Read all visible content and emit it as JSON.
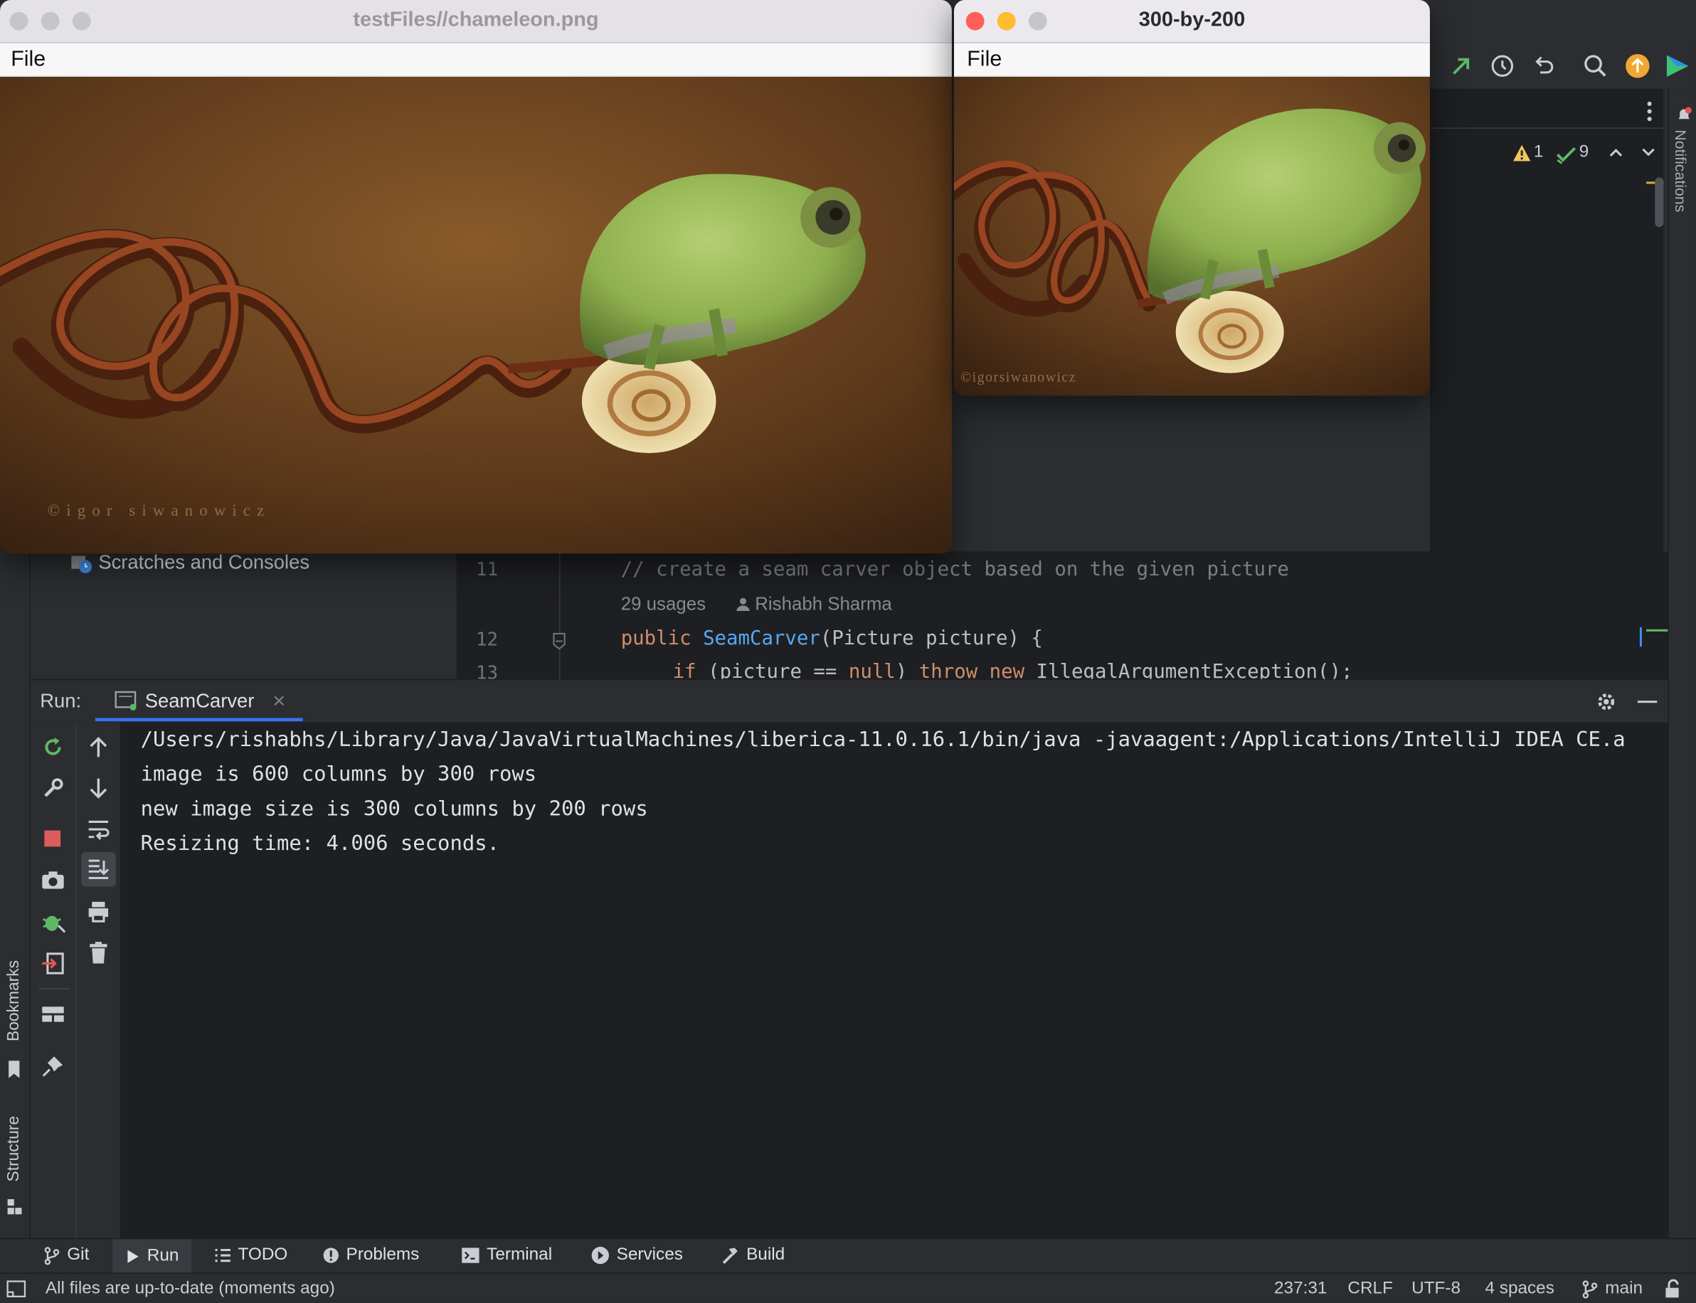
{
  "main_window": {
    "title": "testFiles//chameleon.png",
    "menu_file": "File",
    "watermark": "©igor siwanowicz"
  },
  "resized_window": {
    "title": "300-by-200",
    "menu_file": "File",
    "watermark": "©igorsiwanowicz"
  },
  "ide": {
    "inspections": {
      "warnings": "1",
      "checks": "9"
    },
    "notifications_label": "Notifications",
    "project_panel": {
      "scratches": "Scratches and Consoles"
    },
    "editor": {
      "lines": [
        {
          "number": "11",
          "text": "// create a seam carver object based on the given picture"
        },
        {
          "number": "12",
          "text": ""
        },
        {
          "number": "13",
          "text": ""
        }
      ],
      "usages": "29 usages",
      "author": "Rishabh Sharma",
      "line12": {
        "keyword": "public",
        "method": "SeamCarver",
        "rest": "(Picture picture) {"
      },
      "line13": {
        "kw_if": "if",
        "mid1": " (picture == ",
        "kw_null": "null",
        "mid2": ") ",
        "kw_throw": "throw",
        "sp": " ",
        "kw_new": "new",
        "rest": " IllegalArgumentException();"
      }
    },
    "run": {
      "label": "Run:",
      "tab_name": "SeamCarver",
      "console": [
        "/Users/rishabhs/Library/Java/JavaVirtualMachines/liberica-11.0.16.1/bin/java -javaagent:/Applications/IntelliJ IDEA CE.a",
        "image is 600 columns by 300 rows",
        "new image size is 300 columns by 200 rows",
        "Resizing time: 4.006 seconds."
      ]
    },
    "side_labels": {
      "bookmarks": "Bookmarks",
      "structure": "Structure"
    },
    "bottom_tabs": [
      "Git",
      "Run",
      "TODO",
      "Problems",
      "Terminal",
      "Services",
      "Build"
    ],
    "status": {
      "message": "All files are up-to-date (moments ago)",
      "position": "237:31",
      "line_sep": "CRLF",
      "encoding": "UTF-8",
      "indent": "4 spaces",
      "branch": "main"
    }
  },
  "colors": {
    "ide_bg": "#2b2d30",
    "editor_bg": "#1e1f22",
    "keyword": "#cf8e6d",
    "method": "#56a8f5",
    "comment": "#7a7e85",
    "close_red": "#ff5f57",
    "min_yellow": "#febc2e",
    "zoom_gray": "#c6c5c8"
  }
}
